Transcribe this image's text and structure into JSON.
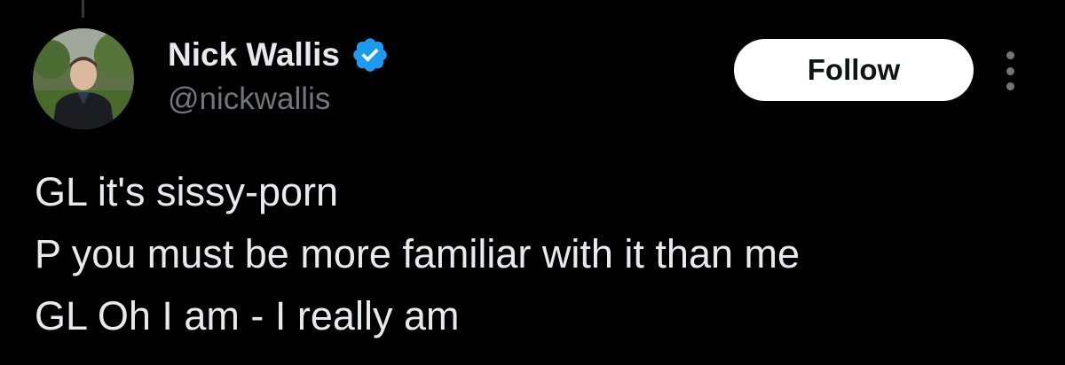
{
  "author": {
    "display_name": "Nick Wallis",
    "handle": "@nickwallis",
    "verified": true,
    "avatar_icon": "profile-photo"
  },
  "actions": {
    "follow_label": "Follow",
    "more_icon": "more-vertical-icon"
  },
  "tweet": {
    "lines": [
      "GL it's sissy-porn",
      "P you must be more familiar with it than me",
      "GL Oh I am - I really am"
    ]
  },
  "colors": {
    "background": "#000000",
    "primary_text": "#e7e9ea",
    "secondary_text": "#71767b",
    "verified_badge": "#1d9bf0",
    "follow_button_bg": "#ffffff",
    "follow_button_text": "#0f1419"
  }
}
